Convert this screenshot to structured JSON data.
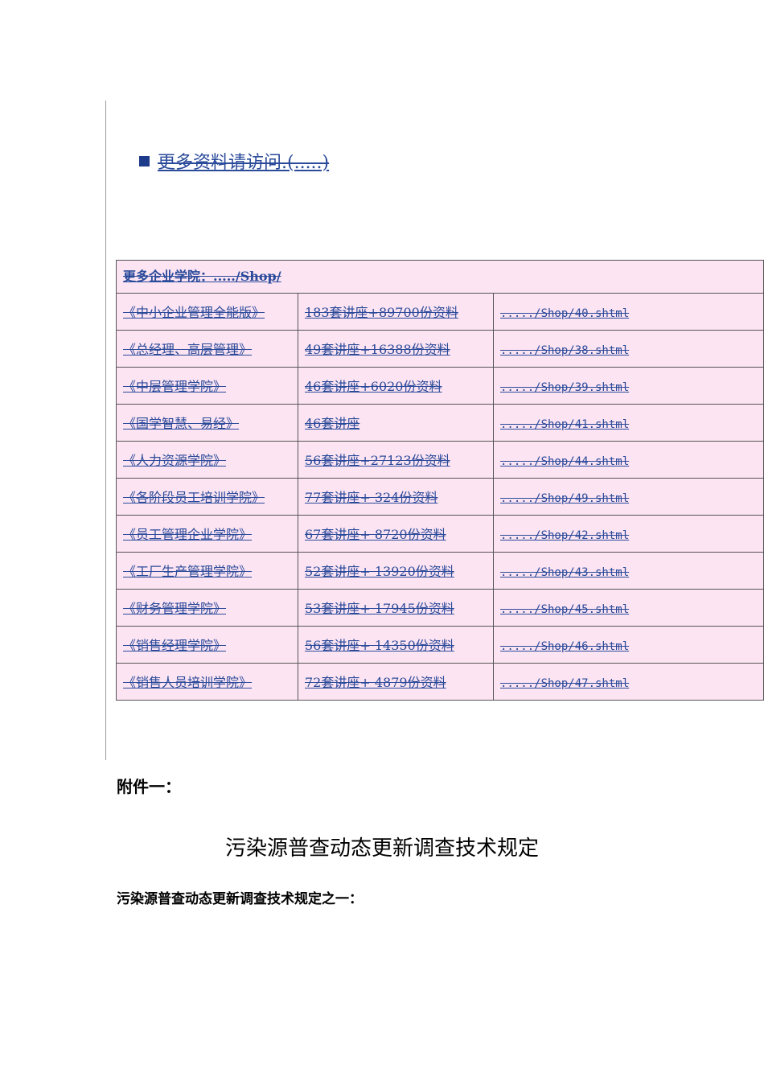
{
  "more_link": "更多资料请访问.(.....)",
  "table": {
    "header": "更多企业学院：...../Shop/",
    "rows": [
      [
        "《中小企业管理全能版》",
        "183套讲座+89700份资料",
        "...../Shop/40.shtml"
      ],
      [
        "《总经理、高层管理》",
        "49套讲座+16388份资料",
        "...../Shop/38.shtml"
      ],
      [
        "《中层管理学院》",
        "46套讲座+6020份资料",
        "...../Shop/39.shtml"
      ],
      [
        "《国学智慧、易经》",
        "46套讲座",
        "...../Shop/41.shtml"
      ],
      [
        "《人力资源学院》",
        "56套讲座+27123份资料",
        "...../Shop/44.shtml"
      ],
      [
        "《各阶段员工培训学院》",
        "77套讲座+ 324份资料",
        "...../Shop/49.shtml"
      ],
      [
        "《员工管理企业学院》",
        "67套讲座+ 8720份资料",
        "...../Shop/42.shtml"
      ],
      [
        "《工厂生产管理学院》",
        "52套讲座+ 13920份资料",
        "...../Shop/43.shtml"
      ],
      [
        "《财务管理学院》",
        "53套讲座+ 17945份资料",
        "...../Shop/45.shtml"
      ],
      [
        "《销售经理学院》",
        "56套讲座+ 14350份资料",
        "...../Shop/46.shtml"
      ],
      [
        "《销售人员培训学院》",
        "72套讲座+ 4879份资料",
        "...../Shop/47.shtml"
      ]
    ]
  },
  "attachment": "附件一：",
  "doc_title": "污染源普查动态更新调查技术规定",
  "section_title": "污染源普查动态更新调查技术规定之一："
}
